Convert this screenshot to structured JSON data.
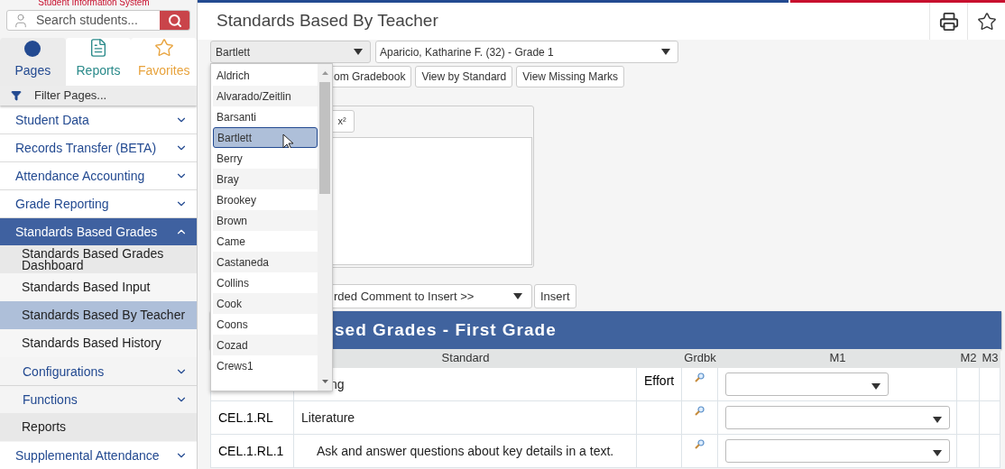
{
  "sidebar": {
    "app_subtitle": "Student Information System",
    "search": {
      "placeholder": "Search students..."
    },
    "tabs": [
      {
        "label": "Pages",
        "kind": "pages",
        "selected": true
      },
      {
        "label": "Reports",
        "kind": "reports",
        "selected": false
      },
      {
        "label": "Favorites",
        "kind": "favorites",
        "selected": false
      }
    ],
    "filter": {
      "placeholder": "Filter Pages..."
    },
    "menu": [
      {
        "label": "Student Data",
        "expanded": false
      },
      {
        "label": "Records Transfer (BETA)",
        "expanded": false
      },
      {
        "label": "Attendance Accounting",
        "expanded": false
      },
      {
        "label": "Grade Reporting",
        "expanded": false
      },
      {
        "label": "Standards Based Grades",
        "expanded": true,
        "children": [
          {
            "kind": "page",
            "label": "Standards Based Grades Dashboard",
            "selected": false
          },
          {
            "kind": "page",
            "label": "Standards Based Input",
            "selected": false
          },
          {
            "kind": "page",
            "label": "Standards Based By Teacher",
            "selected": true
          },
          {
            "kind": "page",
            "label": "Standards Based History",
            "selected": false
          },
          {
            "kind": "group",
            "label": "Configurations",
            "expanded": false
          },
          {
            "kind": "group",
            "label": "Functions",
            "expanded": false
          },
          {
            "kind": "page",
            "label": "Reports",
            "selected": false
          }
        ]
      },
      {
        "label": "Supplemental Attendance",
        "expanded": false
      }
    ]
  },
  "page_title": "Standards Based By Teacher",
  "teacher_select": {
    "value": "Bartlett",
    "expanded": true,
    "options": [
      {
        "label": "Aldrich",
        "selected": false
      },
      {
        "label": "Alvarado/Zeitlin",
        "selected": false
      },
      {
        "label": "Barsanti",
        "selected": false
      },
      {
        "label": "Bartlett",
        "selected": true
      },
      {
        "label": "Berry",
        "selected": false
      },
      {
        "label": "Bray",
        "selected": false
      },
      {
        "label": "Brookey",
        "selected": false
      },
      {
        "label": "Brown",
        "selected": false
      },
      {
        "label": "Came",
        "selected": false
      },
      {
        "label": "Castaneda",
        "selected": false
      },
      {
        "label": "Collins",
        "selected": false
      },
      {
        "label": "Cook",
        "selected": false
      },
      {
        "label": "Coons",
        "selected": false
      },
      {
        "label": "Cozad",
        "selected": false
      },
      {
        "label": "Crews1",
        "selected": false
      }
    ]
  },
  "student_select": {
    "value": "Aparicio, Katharine F. (32) - Grade 1"
  },
  "buttons": [
    "om Gradebook",
    "View by Standard",
    "View Missing Marks"
  ],
  "editor": {
    "toolbar": [
      "x²"
    ]
  },
  "comment_select": {
    "value": "rded Comment to Insert >>"
  },
  "insert_button": "Insert",
  "grades_table": {
    "title": "sed Grades - First Grade",
    "columns": [
      "Standard",
      "Grdbk",
      "M1",
      "M2",
      "M3"
    ],
    "rows": [
      {
        "kind": "category",
        "standard": "ng",
        "effort": "Effort"
      },
      {
        "kind": "domain",
        "code": "CEL.1.RL",
        "standard": "Literature"
      },
      {
        "kind": "standard",
        "code": "CEL.1.RL.1",
        "standard": "Ask and answer questions about key details in a text."
      }
    ]
  }
}
